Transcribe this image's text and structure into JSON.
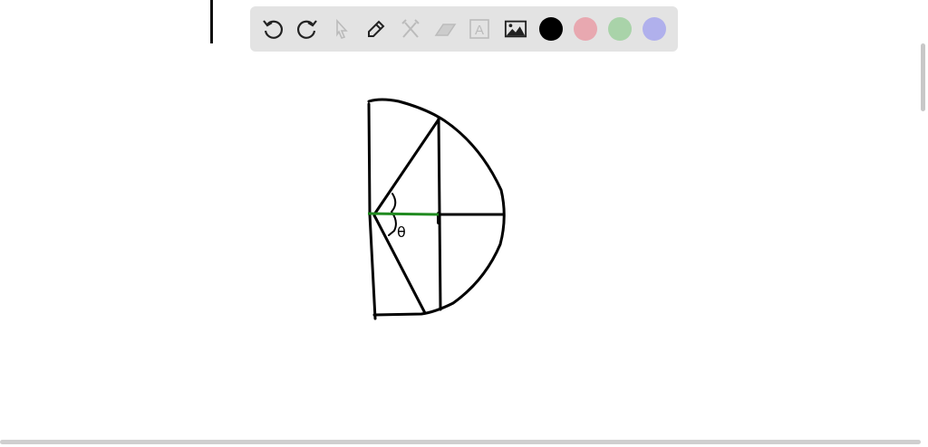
{
  "toolbar": {
    "tools": [
      {
        "name": "undo-icon",
        "enabled": true
      },
      {
        "name": "redo-icon",
        "enabled": true
      },
      {
        "name": "select-pointer-icon",
        "enabled": false
      },
      {
        "name": "pen-icon",
        "enabled": true
      },
      {
        "name": "tools-icon",
        "enabled": false
      },
      {
        "name": "eraser-icon",
        "enabled": false
      },
      {
        "name": "text-icon",
        "enabled": false,
        "label": "A"
      },
      {
        "name": "image-icon",
        "enabled": true
      }
    ],
    "colors": [
      "#000000",
      "#e8a8b0",
      "#a9d3a9",
      "#b0b0ec"
    ]
  },
  "drawing": {
    "angle_label": "θ",
    "stroke_color": "#000000",
    "highlight_color": "#1f8a1f"
  }
}
